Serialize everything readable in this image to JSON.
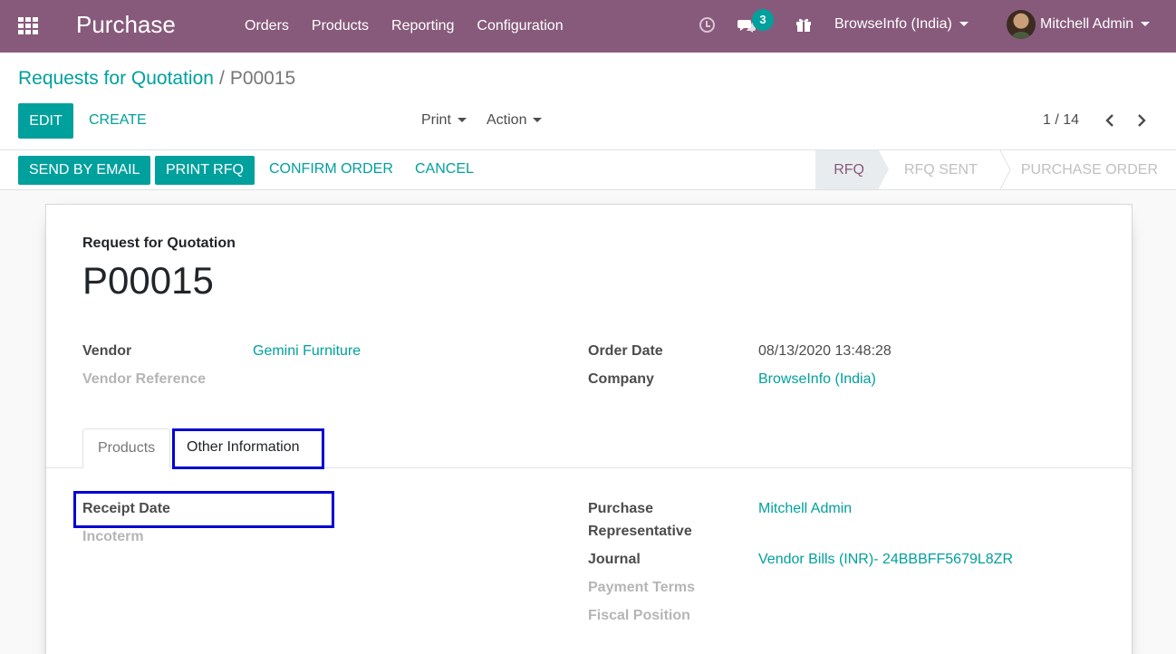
{
  "navbar": {
    "brand": "Purchase",
    "menu": [
      "Orders",
      "Products",
      "Reporting",
      "Configuration"
    ],
    "messages_badge": "3",
    "company": "BrowseInfo (India)",
    "user": "Mitchell Admin",
    "color": "#875a7b"
  },
  "breadcrumb": {
    "parent": "Requests for Quotation",
    "separator": "/",
    "current": "P00015"
  },
  "toolbar": {
    "edit": "EDIT",
    "create": "CREATE",
    "print": "Print",
    "action": "Action",
    "pager": "1 / 14"
  },
  "statusbar": {
    "send_email": "SEND BY EMAIL",
    "print_rfq": "PRINT RFQ",
    "confirm": "CONFIRM ORDER",
    "cancel": "CANCEL",
    "stages": [
      "RFQ",
      "RFQ SENT",
      "PURCHASE ORDER"
    ],
    "active_stage": "RFQ"
  },
  "form": {
    "doc_label": "Request for Quotation",
    "doc_name": "P00015",
    "vendor_label": "Vendor",
    "vendor_value": "Gemini Furniture",
    "vendor_ref_label": "Vendor Reference",
    "order_date_label": "Order Date",
    "order_date_value": "08/13/2020 13:48:28",
    "company_label": "Company",
    "company_value": "BrowseInfo (India)"
  },
  "tabs": {
    "products": "Products",
    "other_info": "Other Information",
    "active": "Other Information"
  },
  "other_info": {
    "receipt_date_label": "Receipt Date",
    "incoterm_label": "Incoterm",
    "rep_label_line1": "Purchase",
    "rep_label_line2": "Representative",
    "rep_value": "Mitchell Admin",
    "journal_label": "Journal",
    "journal_value": "Vendor Bills (INR)- 24BBBFF5679L8ZR",
    "payment_terms_label": "Payment Terms",
    "fiscal_position_label": "Fiscal Position"
  },
  "colors": {
    "accent": "#00a09d",
    "highlight": "#0000d4"
  }
}
